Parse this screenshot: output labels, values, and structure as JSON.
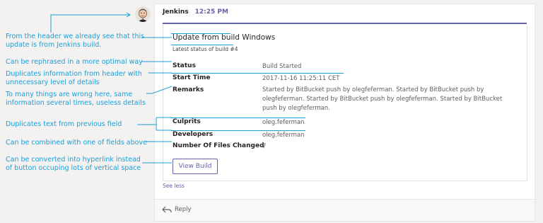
{
  "annotations": [
    "From the header we already see that this update is from Jenkins build.",
    "Can be rephrased in a more optimal way",
    "Duplicates information from header with unnecessary level of details",
    "To many things are wrong here, same information several times, useless details",
    "Duplicates text from previous field",
    "Can be combined with one of fields above",
    "Can be converted into hyperlink instead of button occuping lots of vertical space"
  ],
  "message": {
    "sender": "Jenkins",
    "time": "12:25 PM",
    "avatar_icon": "jenkins-butler-icon",
    "title_struck": "Update from build",
    "title_rest": " Windows",
    "subtitle": "Latest status of build #4",
    "facts": [
      {
        "label": "Status",
        "value": "Build Started"
      },
      {
        "label": "Start Time",
        "value": "2017-11-16 11:25:11 CET"
      },
      {
        "label": "Remarks",
        "value": "Started by BitBucket push by olegfeferman. Started by BitBucket push by olegfeferman. Started by BitBucket push by olegfeferman. Started by BitBucket push by olegfeferman."
      },
      {
        "label": "Culprits",
        "value": "oleg.feferman"
      },
      {
        "label": "Developers",
        "value": "oleg.feferman"
      },
      {
        "label": "Number Of Files Changed",
        "value": "7"
      }
    ],
    "view_build_label": "View Build",
    "see_less_label": "See less",
    "reply_label": "Reply",
    "reply_icon": "reply-arrow-icon"
  },
  "colors": {
    "annotation": "#1a9fd8",
    "accent": "#6264a7",
    "strike": "#1a9fd8"
  }
}
